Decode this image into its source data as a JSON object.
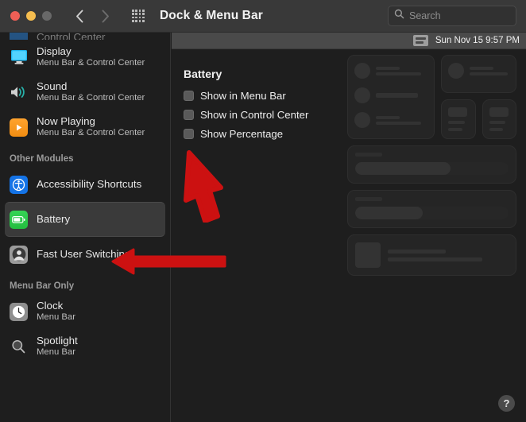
{
  "window": {
    "title": "Dock & Menu Bar",
    "traffic_lights": [
      "close-red",
      "minimize-yellow",
      "zoom-gray-disabled"
    ],
    "nav": {
      "back": "back-chevron",
      "forward": "forward-chevron",
      "grid": "show-all-grid"
    },
    "search": {
      "placeholder": "Search",
      "value": ""
    }
  },
  "colors": {
    "window_bg": "#1e1e1e",
    "titlebar_bg": "#393939",
    "selected_row": "#3a3a3a",
    "accent_red_arrow": "#cc1111",
    "battery_green": "#2ecc4a",
    "accessibility_blue": "#1473e6",
    "nowplaying_orange": "#ffa32e"
  },
  "sidebar": {
    "cut_item": {
      "label": "Control Center"
    },
    "items": [
      {
        "label": "Display",
        "sub": "Menu Bar & Control Center",
        "icon": "display-icon",
        "selected": false
      },
      {
        "label": "Sound",
        "sub": "Menu Bar & Control Center",
        "icon": "sound-icon",
        "selected": false
      },
      {
        "label": "Now Playing",
        "sub": "Menu Bar & Control Center",
        "icon": "now-playing-icon",
        "selected": false
      }
    ],
    "group_other_modules": {
      "header": "Other Modules",
      "items": [
        {
          "label": "Accessibility Shortcuts",
          "sub": "",
          "icon": "accessibility-icon",
          "selected": false
        },
        {
          "label": "Battery",
          "sub": "",
          "icon": "battery-icon",
          "selected": true
        },
        {
          "label": "Fast User Switching",
          "sub": "",
          "icon": "fast-user-switching-icon",
          "selected": false
        }
      ]
    },
    "group_menu_bar_only": {
      "header": "Menu Bar Only",
      "items": [
        {
          "label": "Clock",
          "sub": "Menu Bar",
          "icon": "clock-icon",
          "selected": false
        },
        {
          "label": "Spotlight",
          "sub": "Menu Bar",
          "icon": "spotlight-icon",
          "selected": false
        }
      ]
    }
  },
  "main": {
    "menu_bar_preview": {
      "time": "Sun Nov 15  9:57 PM",
      "icon": "control-center-icon"
    },
    "section_title": "Battery",
    "checkboxes": [
      {
        "label": "Show in Menu Bar",
        "checked": false
      },
      {
        "label": "Show in Control Center",
        "checked": false
      },
      {
        "label": "Show Percentage",
        "checked": false
      }
    ],
    "help_button": "?"
  },
  "annotations": {
    "arrow_up": "red-arrow-pointing-to-show-percentage",
    "arrow_left": "red-arrow-pointing-to-battery-sidebar-item"
  }
}
